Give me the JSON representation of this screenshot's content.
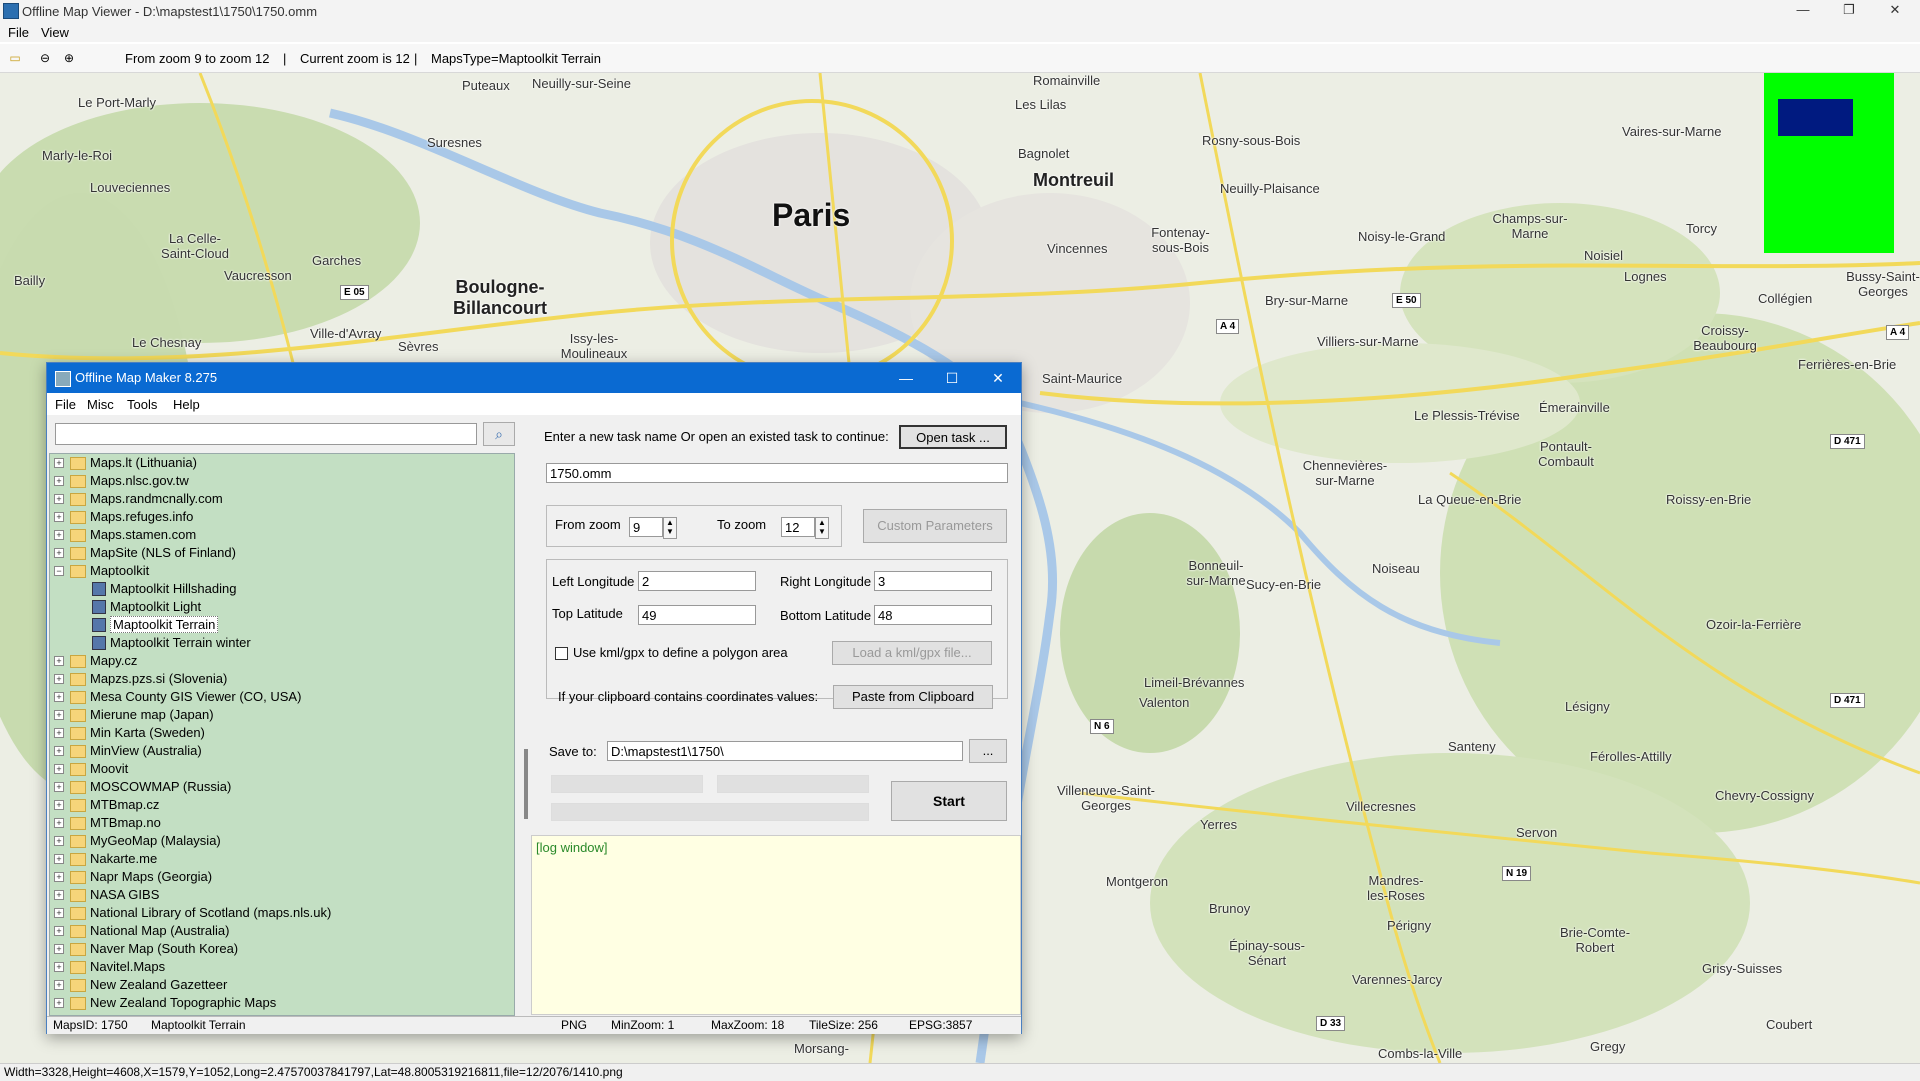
{
  "window": {
    "title": "Offline Map Viewer - D:\\mapstest1\\1750\\1750.omm",
    "minimize": "—",
    "maximize": "❐",
    "close": "✕"
  },
  "menubar": {
    "file": "File",
    "view": "View"
  },
  "toolbar": {
    "zoom_range": "From zoom 9 to zoom 12",
    "sep1": "|",
    "current_zoom": "Current zoom is 12",
    "sep2": "|",
    "maps_type": "MapsType=Maptoolkit Terrain"
  },
  "map": {
    "labels": [
      "Puteaux",
      "Neuilly-sur-Seine",
      "Romainville",
      "Le Port-Marly",
      "Les Lilas",
      "Marly-le-Roi",
      "Suresnes",
      "Bagnolet",
      "Rosny-sous-Bois",
      "Vaires-sur-Marne",
      "Louveciennes",
      "Montreuil",
      "Neuilly-Plaisance",
      "Paris",
      "Champs-sur-Marne",
      "Torcy",
      "La Celle-Saint-Cloud",
      "Vincennes",
      "Fontenay-sous-Bois",
      "Noisy-le-Grand",
      "Noisiel",
      "Garches",
      "Boulogne-Billancourt",
      "Bailly",
      "Vaucresson",
      "Lognes",
      "Bussy-Saint-Georges",
      "Le Chesnay",
      "Ville-d'Avray",
      "Bry-sur-Marne",
      "Collégien",
      "Issy-les-Moulineaux",
      "Sèvres",
      "Villiers-sur-Marne",
      "Croissy-Beaubourg",
      "Ferrières-en-Brie",
      "Saint-Maurice",
      "Le Plessis-Trévise",
      "Émerainville",
      "Pontault-Combault",
      "Chennevières-sur-Marne",
      "La Queue-en-Brie",
      "Roissy-en-Brie",
      "Sucy-en-Brie",
      "Bonneuil-sur-Marne",
      "Noiseau",
      "Ozoir-la-Ferrière",
      "Limeil-Brévannes",
      "Valenton",
      "Lésigny",
      "Villeneuve-Saint-Georges",
      "Santeny",
      "Férolles-Attilly",
      "Chevry-Cossigny",
      "Villecresnes",
      "Yerres",
      "Servon",
      "Montgeron",
      "Brunoy",
      "Mandres-les-Roses",
      "Périgny",
      "Brie-Comte-Robert",
      "Épinay-sous-Sénart",
      "Varennes-Jarcy",
      "Grisy-Suisses",
      "Coubert",
      "Combs-la-Ville",
      "Gregy",
      "Morsang-"
    ],
    "shields": [
      "E 05",
      "A 4",
      "E 50",
      "A 4",
      "D 471",
      "D 471",
      "N 6",
      "N 19",
      "D 33"
    ]
  },
  "status": "Width=3328,Height=4608,X=1579,Y=1052,Long=2.47570037841797,Lat=48.8005319216811,file=12/2076/1410.png",
  "dialog": {
    "title": "Offline Map Maker 8.275",
    "menu": {
      "file": "File",
      "misc": "Misc",
      "tools": "Tools",
      "help": "Help"
    },
    "search_placeholder": "",
    "tree": [
      {
        "label": "Maps.lt (Lithuania)",
        "level": 0,
        "type": "folder",
        "exp": "+"
      },
      {
        "label": "Maps.nlsc.gov.tw",
        "level": 0,
        "type": "folder",
        "exp": "+"
      },
      {
        "label": "Maps.randmcnally.com",
        "level": 0,
        "type": "folder",
        "exp": "+"
      },
      {
        "label": "Maps.refuges.info",
        "level": 0,
        "type": "folder",
        "exp": "+"
      },
      {
        "label": "Maps.stamen.com",
        "level": 0,
        "type": "folder",
        "exp": "+"
      },
      {
        "label": "MapSite (NLS of Finland)",
        "level": 0,
        "type": "folder",
        "exp": "+"
      },
      {
        "label": "Maptoolkit",
        "level": 0,
        "type": "folder",
        "exp": "−"
      },
      {
        "label": "Maptoolkit Hillshading",
        "level": 1,
        "type": "map"
      },
      {
        "label": "Maptoolkit Light",
        "level": 1,
        "type": "map"
      },
      {
        "label": "Maptoolkit Terrain",
        "level": 1,
        "type": "map",
        "selected": true
      },
      {
        "label": "Maptoolkit Terrain winter",
        "level": 1,
        "type": "map"
      },
      {
        "label": "Mapy.cz",
        "level": 0,
        "type": "folder",
        "exp": "+"
      },
      {
        "label": "Mapzs.pzs.si (Slovenia)",
        "level": 0,
        "type": "folder",
        "exp": "+"
      },
      {
        "label": "Mesa County GIS Viewer (CO, USA)",
        "level": 0,
        "type": "folder",
        "exp": "+"
      },
      {
        "label": "Mierune map (Japan)",
        "level": 0,
        "type": "folder",
        "exp": "+"
      },
      {
        "label": "Min Karta (Sweden)",
        "level": 0,
        "type": "folder",
        "exp": "+"
      },
      {
        "label": "MinView (Australia)",
        "level": 0,
        "type": "folder",
        "exp": "+"
      },
      {
        "label": "Moovit",
        "level": 0,
        "type": "folder",
        "exp": "+"
      },
      {
        "label": "MOSCOWMAP (Russia)",
        "level": 0,
        "type": "folder",
        "exp": "+"
      },
      {
        "label": "MTBmap.cz",
        "level": 0,
        "type": "folder",
        "exp": "+"
      },
      {
        "label": "MTBmap.no",
        "level": 0,
        "type": "folder",
        "exp": "+"
      },
      {
        "label": "MyGeoMap (Malaysia)",
        "level": 0,
        "type": "folder",
        "exp": "+"
      },
      {
        "label": "Nakarte.me",
        "level": 0,
        "type": "folder",
        "exp": "+"
      },
      {
        "label": "Napr Maps (Georgia)",
        "level": 0,
        "type": "folder",
        "exp": "+"
      },
      {
        "label": "NASA GIBS",
        "level": 0,
        "type": "folder",
        "exp": "+"
      },
      {
        "label": "National Library of Scotland (maps.nls.uk)",
        "level": 0,
        "type": "folder",
        "exp": "+"
      },
      {
        "label": "National Map (Australia)",
        "level": 0,
        "type": "folder",
        "exp": "+"
      },
      {
        "label": "Naver Map (South Korea)",
        "level": 0,
        "type": "folder",
        "exp": "+"
      },
      {
        "label": "Navitel.Maps",
        "level": 0,
        "type": "folder",
        "exp": "+"
      },
      {
        "label": "New Zealand Gazetteer",
        "level": 0,
        "type": "folder",
        "exp": "+"
      },
      {
        "label": "New Zealand Topographic Maps",
        "level": 0,
        "type": "folder",
        "exp": "+"
      }
    ],
    "task_prompt": "Enter a new task name Or open an existed task to continue:",
    "open_task": "Open task ...",
    "task_name": "1750.omm",
    "from_zoom_label": "From zoom",
    "from_zoom": "9",
    "to_zoom_label": "To zoom",
    "to_zoom": "12",
    "custom_params": "Custom Parameters",
    "left_lon_label": "Left Longitude",
    "left_lon": "2",
    "right_lon_label": "Right Longitude",
    "right_lon": "3",
    "top_lat_label": "Top Latitude",
    "top_lat": "49",
    "bottom_lat_label": "Bottom Latitude",
    "bottom_lat": "48",
    "kml_label": "Use kml/gpx to define a polygon area",
    "load_kml": "Load a kml/gpx file...",
    "clipboard_label": "If your clipboard contains coordinates values:",
    "paste_clipboard": "Paste from Clipboard",
    "save_to_label": "Save to:",
    "save_to": "D:\\mapstest1\\1750\\",
    "browse": "...",
    "start": "Start",
    "log": "[log window]",
    "status": {
      "maps_id": "MapsID: 1750",
      "map_name": "Maptoolkit Terrain",
      "format": "PNG",
      "min_zoom": "MinZoom: 1",
      "max_zoom": "MaxZoom: 18",
      "tile_size": "TileSize: 256",
      "epsg": "EPSG:3857"
    }
  }
}
